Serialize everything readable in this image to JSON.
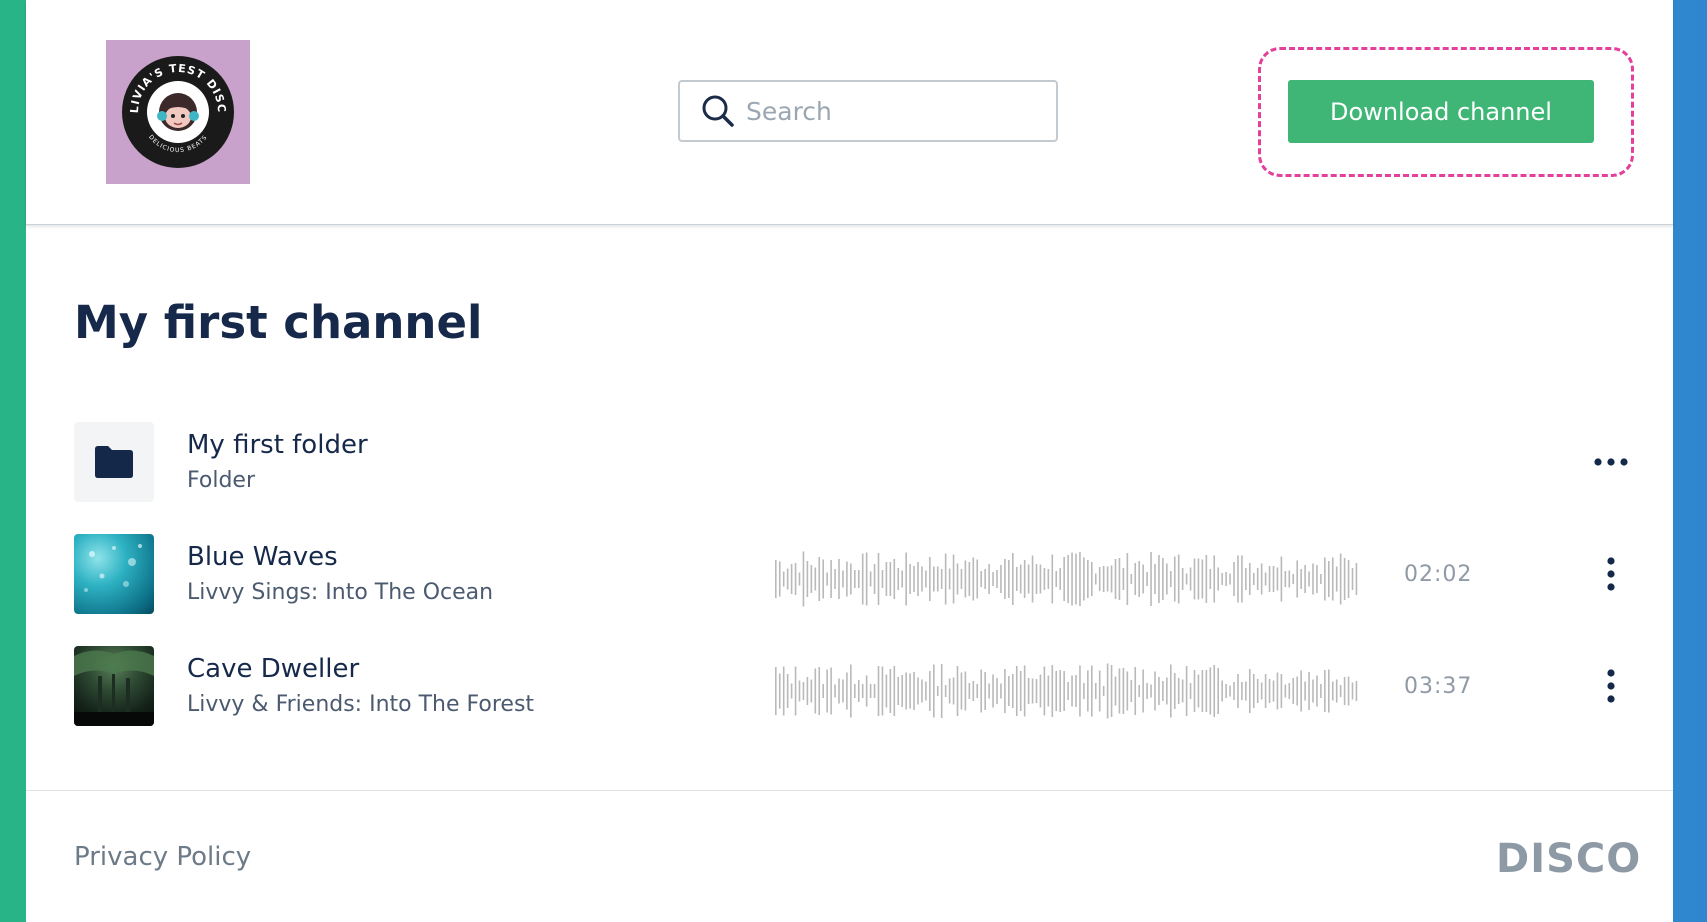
{
  "header": {
    "logo": {
      "ring_text_top": "OLIVIA'S TEST DISCO",
      "ring_text_bottom": "DELICIOUS BEATS"
    },
    "search": {
      "placeholder": "Search",
      "value": ""
    },
    "download_label": "Download channel"
  },
  "channel": {
    "title": "My first channel",
    "items": [
      {
        "title": "My first folder",
        "subtitle": "Folder",
        "icon": "folder-icon"
      },
      {
        "title": "Blue Waves",
        "subtitle": "Livvy Sings: Into The Ocean",
        "duration": "02:02",
        "thumb": "ocean"
      },
      {
        "title": "Cave Dweller",
        "subtitle": "Livvy & Friends: Into The Forest",
        "duration": "03:37",
        "thumb": "forest"
      }
    ]
  },
  "footer": {
    "privacy_label": "Privacy Policy",
    "brand": "DISCO"
  },
  "colors": {
    "accent_green": "#3fb676",
    "highlight_pink": "#e43f9a",
    "navy_text": "#16294a",
    "waveform_gray": "#b9b9b9"
  }
}
